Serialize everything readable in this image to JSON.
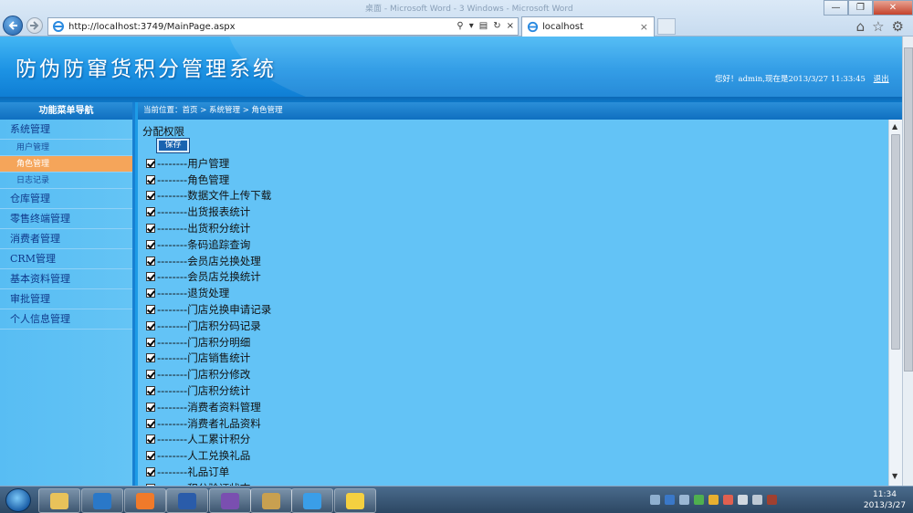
{
  "browser": {
    "window_title": "桌面 - Microsoft Word - 3 Windows - Microsoft Word",
    "address": "http://localhost:3749/MainPage.aspx",
    "tab_label": "localhost",
    "tab_close": "×",
    "window_controls": {
      "minimize": "—",
      "restore": "❐",
      "close": "✕"
    },
    "toolbar_icons": [
      "home-icon",
      "favorites-icon",
      "settings-icon"
    ]
  },
  "header": {
    "system_title": "防伪防窜货积分管理系统",
    "greeting": "您好！admin,现在是2013/3/27 11:33:45",
    "logout_label": "退出"
  },
  "sidebar": {
    "heading": "功能菜单导航",
    "categories": [
      {
        "label": "系统管理",
        "items": [
          {
            "label": "用户管理",
            "active": false
          },
          {
            "label": "角色管理",
            "active": true
          },
          {
            "label": "日志记录",
            "active": false
          }
        ]
      },
      {
        "label": "仓库管理"
      },
      {
        "label": "零售终端管理"
      },
      {
        "label": "消费者管理"
      },
      {
        "label": "CRM管理"
      },
      {
        "label": "基本资料管理"
      },
      {
        "label": "审批管理"
      },
      {
        "label": "个人信息管理"
      }
    ]
  },
  "breadcrumb": {
    "label": "当前位置：首页 > 系统管理 > 角色管理"
  },
  "permissions": {
    "title": "分配权限",
    "save_label": "保存",
    "items": [
      {
        "label": "--------用户管理",
        "checked": true
      },
      {
        "label": "--------角色管理",
        "checked": true
      },
      {
        "label": "--------数据文件上传下载",
        "checked": true
      },
      {
        "label": "--------出货报表统计",
        "checked": true
      },
      {
        "label": "--------出货积分统计",
        "checked": true
      },
      {
        "label": "--------条码追踪查询",
        "checked": true
      },
      {
        "label": "--------会员店兑换处理",
        "checked": true
      },
      {
        "label": "--------会员店兑换统计",
        "checked": true
      },
      {
        "label": "--------退货处理",
        "checked": true
      },
      {
        "label": "--------门店兑换申请记录",
        "checked": true
      },
      {
        "label": "--------门店积分码记录",
        "checked": true
      },
      {
        "label": "--------门店积分明细",
        "checked": true
      },
      {
        "label": "--------门店销售统计",
        "checked": true
      },
      {
        "label": "--------门店积分修改",
        "checked": true
      },
      {
        "label": "--------门店积分统计",
        "checked": true
      },
      {
        "label": "--------消费者资料管理",
        "checked": true
      },
      {
        "label": "--------消费者礼品资料",
        "checked": true
      },
      {
        "label": "--------人工累计积分",
        "checked": true
      },
      {
        "label": "--------人工兑换礼品",
        "checked": true
      },
      {
        "label": "--------礼品订单",
        "checked": true
      },
      {
        "label": "--------积分验证状态",
        "checked": true
      }
    ]
  },
  "taskbar": {
    "apps": [
      {
        "name": "file-explorer-icon",
        "color": "#e8c25a"
      },
      {
        "name": "sogou-icon",
        "color": "#2a78c8"
      },
      {
        "name": "pen-tool-icon",
        "color": "#f07a2a"
      },
      {
        "name": "word-icon",
        "color": "#2a5caa"
      },
      {
        "name": "visual-studio-icon",
        "color": "#7a4fb0"
      },
      {
        "name": "tools-icon",
        "color": "#c8a050"
      },
      {
        "name": "internet-explorer-icon",
        "color": "#3a9ee8"
      },
      {
        "name": "sticky-notes-icon",
        "color": "#f5d040"
      }
    ],
    "clock_time": "11:34",
    "clock_date": "2013/3/27"
  }
}
